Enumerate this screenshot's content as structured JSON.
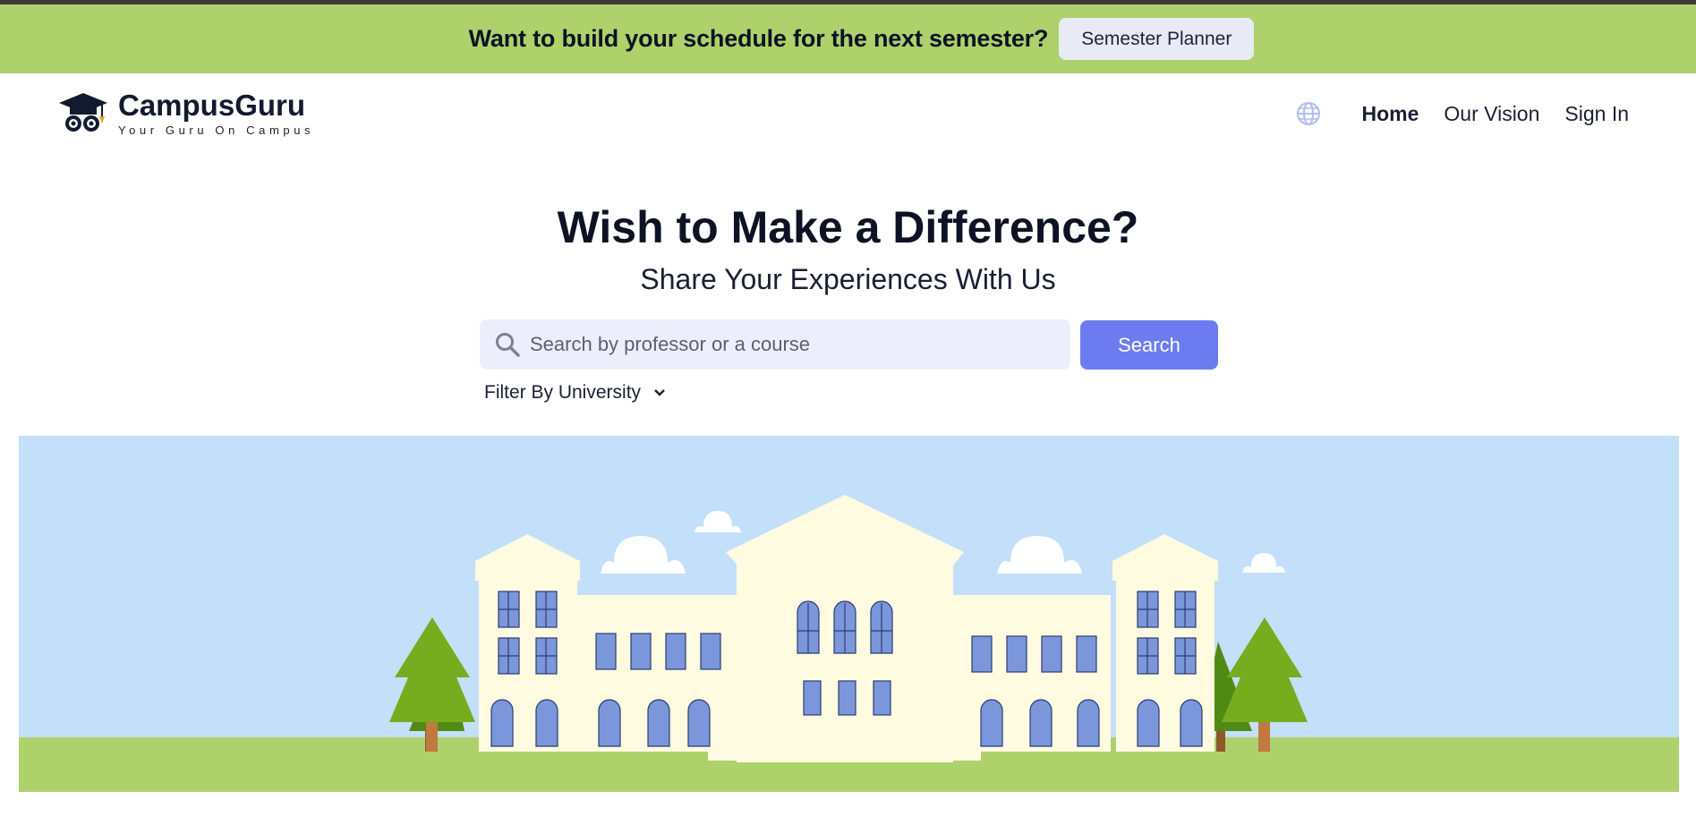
{
  "banner": {
    "text": "Want to build your schedule for the next semester?",
    "button_label": "Semester Planner"
  },
  "brand": {
    "name": "CampusGuru",
    "tagline": "Your Guru On Campus"
  },
  "nav": {
    "globe_icon": "globe-icon",
    "items": [
      {
        "label": "Home",
        "active": true
      },
      {
        "label": "Our Vision",
        "active": false
      },
      {
        "label": "Sign In",
        "active": false
      }
    ]
  },
  "hero": {
    "title": "Wish to Make a Difference?",
    "subtitle": "Share Your Experiences With Us"
  },
  "search": {
    "placeholder": "Search by professor or a course",
    "value": "",
    "button_label": "Search",
    "icon": "search-icon"
  },
  "filter": {
    "label": "Filter By University",
    "icon": "chevron-down-icon"
  },
  "colors": {
    "banner_bg": "#aed16c",
    "accent": "#6c7cf0",
    "sky": "#c4dffa",
    "grass": "#aed16c",
    "building": "#fefbe0",
    "window": "#7c96dc",
    "tree": "#76ad1e"
  }
}
